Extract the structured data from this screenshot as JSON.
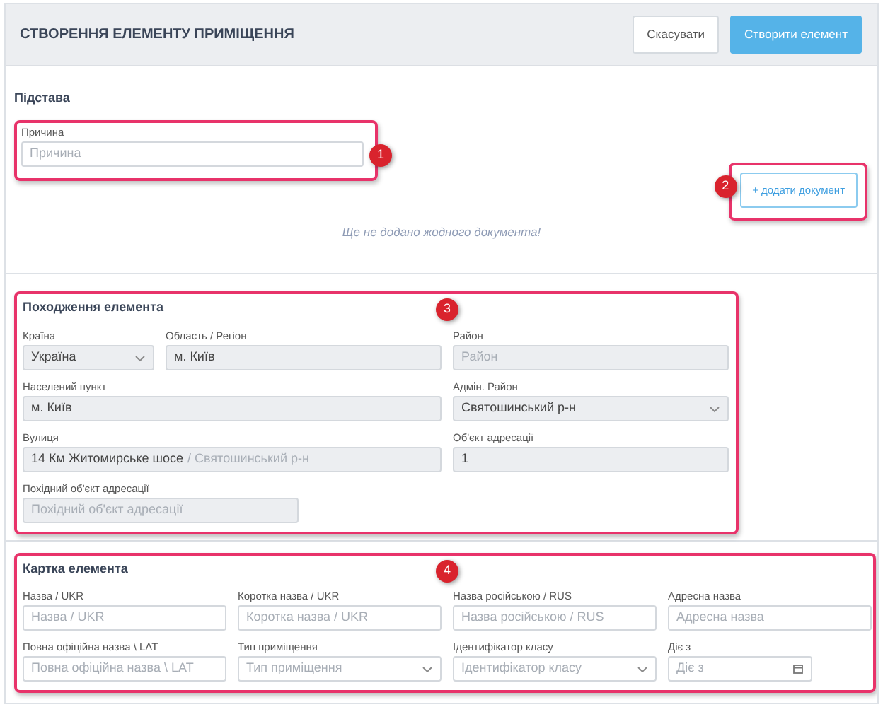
{
  "header": {
    "title": "СТВОРЕННЯ ЕЛЕМЕНТУ ПРИМІЩЕННЯ",
    "buttons": [
      {
        "label": "Скасувати",
        "kind": "secondary"
      },
      {
        "label": "Створити елемент",
        "kind": "primary"
      }
    ]
  },
  "basis": {
    "title": "Підстава",
    "callout": "1",
    "reason": {
      "label": "Причина",
      "placeholder": "Причина",
      "disabled": false
    },
    "add_button": {
      "label": "+ додати документ",
      "callout": "2"
    },
    "empty_text": "Ще не додано жодного документа!"
  },
  "origin": {
    "title": "Походження елемента",
    "callout": "3",
    "fields": [
      {
        "label": "Країна",
        "value": "Україна",
        "kind": "select",
        "disabled": true
      },
      {
        "label": "Область / Регіон",
        "value": "м. Київ",
        "kind": "text",
        "disabled": true
      },
      {
        "label": "Район",
        "placeholder": "Район",
        "kind": "text",
        "disabled": true
      },
      {
        "label": "Населений пункт",
        "value": "м. Київ",
        "kind": "text",
        "disabled": true
      },
      {
        "label": "Адмін. Район",
        "value": "Святошинський р-н",
        "kind": "select",
        "disabled": true
      },
      {
        "label": "Вулиця",
        "value": "14 Км Житомирське шосе",
        "suffix": "/ Святошинський р-н",
        "kind": "text",
        "disabled": true
      },
      {
        "label": "Об'єкт адресації",
        "value": "1",
        "kind": "text",
        "disabled": true
      },
      {
        "label": "Похідний об'єкт адресації",
        "placeholder": "Похідний об'єкт адресації",
        "kind": "text",
        "disabled": true
      }
    ]
  },
  "element_card": {
    "title": "Картка елемента",
    "callout": "4",
    "fields": [
      {
        "label": "Назва / UKR",
        "placeholder": "Назва / UKR",
        "kind": "text",
        "disabled": false
      },
      {
        "label": "Коротка назва / UKR",
        "placeholder": "Коротка назва / UKR",
        "kind": "text",
        "disabled": false
      },
      {
        "label": "Назва російською / RUS",
        "placeholder": "Назва російською / RUS",
        "kind": "text",
        "disabled": false
      },
      {
        "label": "Адресна назва",
        "placeholder": "Адресна назва",
        "kind": "text",
        "disabled": false
      },
      {
        "label": "Повна офіційна назва \\ LAT",
        "placeholder": "Повна офіційна назва \\ LAT",
        "kind": "text",
        "disabled": false
      },
      {
        "label": "Тип приміщення",
        "placeholder": "Тип приміщення",
        "kind": "select",
        "disabled": false
      },
      {
        "label": "Ідентифікатор класу",
        "placeholder": "Ідентифікатор класу",
        "kind": "select",
        "disabled": false
      },
      {
        "label": "Діє з",
        "placeholder": "Діє з",
        "kind": "date",
        "disabled": false
      }
    ]
  }
}
